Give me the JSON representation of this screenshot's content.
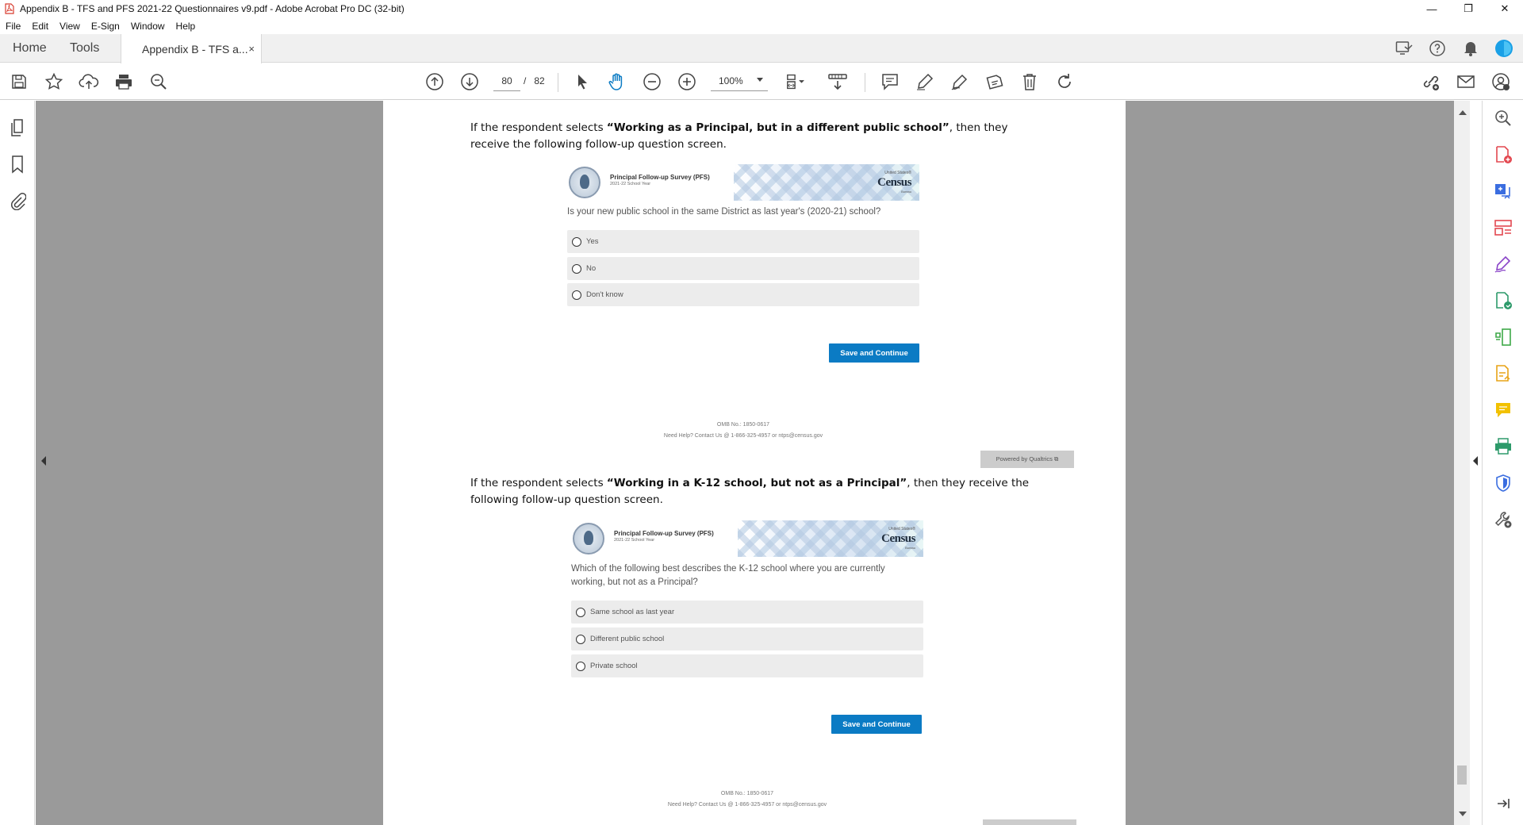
{
  "window": {
    "title": "Appendix B - TFS and PFS 2021-22 Questionnaires v9.pdf - Adobe Acrobat Pro DC (32-bit)",
    "controls": [
      "—",
      "❐",
      "✕"
    ]
  },
  "menu": [
    "File",
    "Edit",
    "View",
    "E-Sign",
    "Window",
    "Help"
  ],
  "tabs": {
    "home": "Home",
    "tools": "Tools",
    "document": "Appendix B - TFS a...",
    "close": "×"
  },
  "toolbar": {
    "current_page": "80",
    "page_separator": "/",
    "total_pages": "82",
    "zoom": "100%"
  },
  "icons": {
    "left_toolbar": [
      "save-icon",
      "bookmark-star-icon",
      "upload-cloud-icon",
      "print-icon",
      "search-zoom-icon"
    ],
    "nav": [
      "prev-page-icon",
      "next-page-icon"
    ],
    "tools": [
      "select-arrow-icon",
      "hand-tool-icon",
      "zoom-out-icon",
      "zoom-in-icon"
    ],
    "view": [
      "page-fit-icon",
      "scroll-mode-icon"
    ],
    "annotate": [
      "comment-icon",
      "highlight-pen-icon",
      "sign-icon",
      "stamp-icon",
      "delete-icon",
      "rotate-icon"
    ],
    "right_toolbar": [
      "share-link-icon",
      "email-icon",
      "account-icon"
    ],
    "left_pane": [
      "pages-icon",
      "bookmarks-icon",
      "attachments-icon"
    ],
    "right_pane": [
      "enhance-scan-icon",
      "export-pdf-icon",
      "create-pdf-icon",
      "organize-pages-icon",
      "fill-sign-icon",
      "edit-pdf-icon",
      "compress-icon",
      "request-signature-icon",
      "comment-tool-icon",
      "print-production-icon",
      "protect-icon",
      "more-tools-icon",
      "expand-pane-icon"
    ]
  },
  "colors": {
    "accent_blue": "#0b7bc4",
    "acrobat_red": "#d83b2e"
  },
  "page": {
    "section1": {
      "intro_pre": "If the respondent selects ",
      "intro_bold": "“Working as a Principal, but in a different public school”",
      "intro_post": ", then they receive the following follow-up question screen.",
      "survey_name": "Principal Follow-up Survey (PFS)",
      "survey_year": "2021-22 School Year",
      "census_us": "United States®",
      "census_name": "Census",
      "census_bureau": "Bureau",
      "question": "Is your new public school in the same District as last year's (2020-21) school?",
      "options": [
        "Yes",
        "No",
        "Don't know"
      ],
      "button": "Save and Continue",
      "omb": "OMB No.: 1850-0617",
      "help": "Need Help? Contact Us @ 1-866-325-4957 or ntps@census.gov",
      "qualtrics": "Powered by Qualtrics ⧉"
    },
    "section2": {
      "intro_pre": "If the respondent selects ",
      "intro_bold": "“Working in a K-12 school, but not as a Principal”",
      "intro_post": ", then they receive the following follow-up question screen.",
      "survey_name": "Principal Follow-up Survey (PFS)",
      "survey_year": "2021-22 School Year",
      "census_us": "United States®",
      "census_name": "Census",
      "census_bureau": "Bureau",
      "question": "Which of the following best describes the K-12 school where you are currently working, but not as a Principal?",
      "options": [
        "Same school as last year",
        "Different public school",
        "Private school"
      ],
      "button": "Save and Continue",
      "omb": "OMB No.: 1850-0617",
      "help": "Need Help? Contact Us @ 1-866-325-4957 or ntps@census.gov"
    }
  }
}
